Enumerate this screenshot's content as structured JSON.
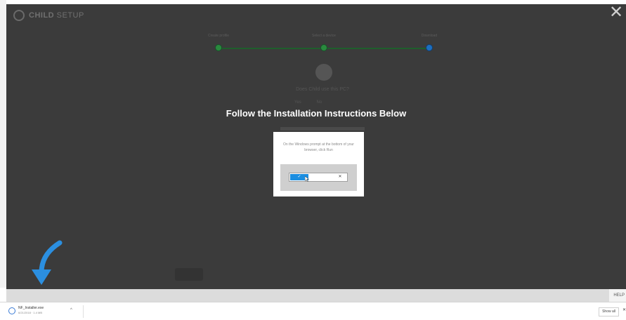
{
  "app": {
    "title_bold": "CHILD",
    "title_light": " SETUP",
    "close_icon": "close-x-icon"
  },
  "stepper": {
    "steps": [
      {
        "label": "Create profile",
        "state": "done"
      },
      {
        "label": "Select a device",
        "state": "done"
      },
      {
        "label": "Download",
        "state": "active"
      }
    ],
    "colors": {
      "done": "#2a8a3e",
      "active": "#1d6fc0"
    }
  },
  "background_form": {
    "question": "Does Child use this PC?",
    "options": [
      "Yes",
      "No"
    ]
  },
  "instruction": {
    "title": "Follow the Installation Instructions Below"
  },
  "dialog": {
    "text": "On the Windows prompt at the bottom of your browser, click Run",
    "run_label": "✓",
    "dismiss_label": "✕"
  },
  "help": {
    "label": "HELP"
  },
  "download_shelf": {
    "file_name": "NF_Installer.exe",
    "file_meta": "6/21/2018 · 1.4 MB",
    "show_all_label": "Show all",
    "close_label": "✕"
  },
  "colors": {
    "overlay": "#3b3b3b",
    "accent_blue": "#1c8ee0",
    "arrow_blue": "#2b8fe0"
  }
}
